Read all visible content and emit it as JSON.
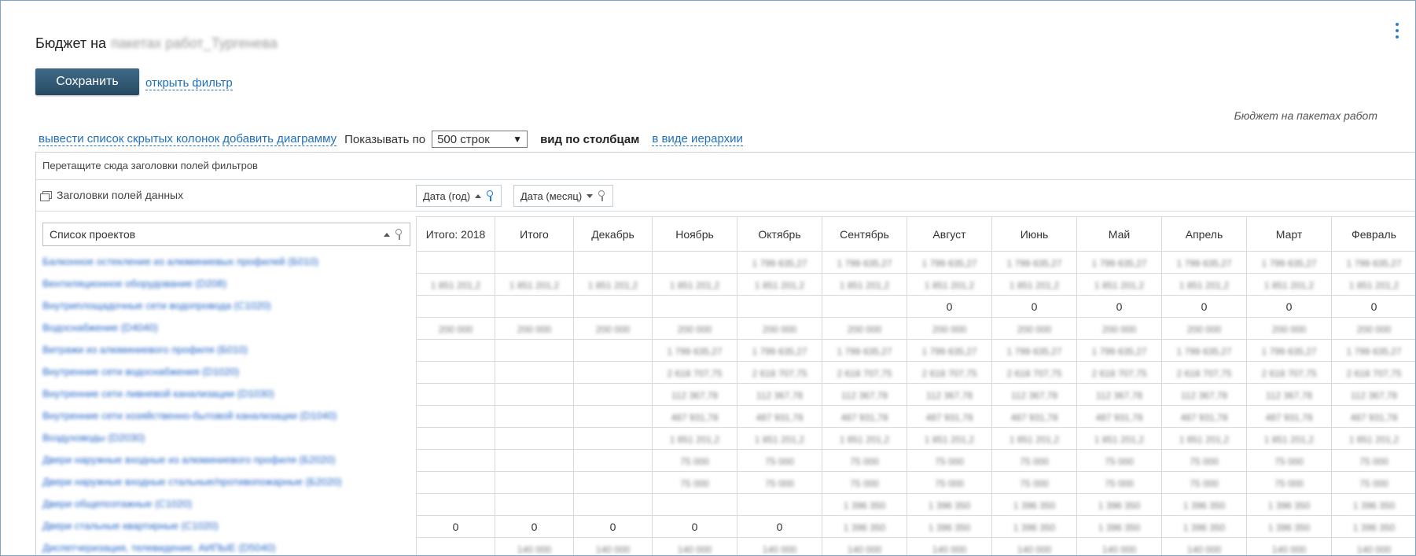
{
  "page": {
    "title_prefix": "Бюджет на",
    "title_blurred": "пакетах работ_Тургенева",
    "save_label": "Сохранить",
    "filter_link": "открыть фильтр",
    "caption": "Бюджет на пакетах работ"
  },
  "toolbar": {
    "hidden_cols_link": "вывести список скрытых колонок",
    "add_chart_link": "добавить диаграмму",
    "show_label": "Показывать по",
    "rows_select": "500 строк",
    "view_columns": "вид по столбцам",
    "view_hierarchy": "в виде иерархии"
  },
  "pivot": {
    "filter_zone": "Перетащите сюда заголовки полей фильтров",
    "data_headers_label": "Заголовки полей данных",
    "field_year": "Дата (год)",
    "field_month": "Дата (месяц)",
    "projects_header": "Список проектов",
    "columns": [
      "Итого: 2018",
      "Итого",
      "Декабрь",
      "Ноябрь",
      "Октябрь",
      "Сентябрь",
      "Август",
      "Июнь",
      "Май",
      "Апрель",
      "Март",
      "Февраль"
    ],
    "rows": [
      {
        "name": "Балконное остекление из алюминиевых профилей (Б010)",
        "cells": [
          "",
          "",
          "",
          "",
          "1 799 635,27",
          "1 799 635,27",
          "1 799 635,27",
          "1 799 635,27",
          "1 799 635,27",
          "1 799 635,27",
          "1 799 635,27",
          "1 799 635,27"
        ]
      },
      {
        "name": "Вентиляционное оборудование (D208)",
        "cells": [
          "1 851 201,2",
          "1 851 201,2",
          "1 851 201,2",
          "1 851 201,2",
          "1 851 201,2",
          "1 851 201,2",
          "1 851 201,2",
          "1 851 201,2",
          "1 851 201,2",
          "1 851 201,2",
          "1 851 201,2",
          "1 851 201,2"
        ]
      },
      {
        "name": "Внутриплощадочные сети водопровода (C1020)",
        "cells": [
          "",
          "",
          "",
          "",
          "",
          "",
          "0",
          "0",
          "0",
          "0",
          "0",
          "0"
        ]
      },
      {
        "name": "Водоснабжение (D4040)",
        "cells": [
          "200 000",
          "200 000",
          "200 000",
          "200 000",
          "200 000",
          "200 000",
          "200 000",
          "200 000",
          "200 000",
          "200 000",
          "200 000",
          "200 000"
        ]
      },
      {
        "name": "Витражи из алюминиевого профиля (Б010)",
        "cells": [
          "",
          "",
          "",
          "1 799 635,27",
          "1 799 635,27",
          "1 799 635,27",
          "1 799 635,27",
          "1 799 635,27",
          "1 799 635,27",
          "1 799 635,27",
          "1 799 635,27",
          "1 799 635,27"
        ]
      },
      {
        "name": "Внутренние сети водоснабжения (D1020)",
        "cells": [
          "",
          "",
          "",
          "2 618 707,75",
          "2 618 707,75",
          "2 618 707,75",
          "2 618 707,75",
          "2 618 707,75",
          "2 618 707,75",
          "2 618 707,75",
          "2 618 707,75",
          "2 618 707,75"
        ]
      },
      {
        "name": "Внутренние сети ливневой канализации (D1030)",
        "cells": [
          "",
          "",
          "",
          "112 367,78",
          "112 367,78",
          "112 367,78",
          "112 367,78",
          "112 367,78",
          "112 367,78",
          "112 367,78",
          "112 367,78",
          "112 367,78"
        ]
      },
      {
        "name": "Внутренние сети хозяйственно-бытовой канализации (D1040)",
        "cells": [
          "",
          "",
          "",
          "487 931,78",
          "487 931,78",
          "487 931,78",
          "487 931,78",
          "487 931,78",
          "487 931,78",
          "487 931,78",
          "487 931,78",
          "487 931,78"
        ]
      },
      {
        "name": "Воздуховоды (D2030)",
        "cells": [
          "",
          "",
          "",
          "1 851 201,2",
          "1 851 201,2",
          "1 851 201,2",
          "1 851 201,2",
          "1 851 201,2",
          "1 851 201,2",
          "1 851 201,2",
          "1 851 201,2",
          "1 851 201,2"
        ]
      },
      {
        "name": "Двери наружные входные из алюминиевого профиля (Б2020)",
        "cells": [
          "",
          "",
          "",
          "75 000",
          "75 000",
          "75 000",
          "75 000",
          "75 000",
          "75 000",
          "75 000",
          "75 000",
          "75 000"
        ]
      },
      {
        "name": "Двери наружные входные стальные/противопожарные (Б2020)",
        "cells": [
          "",
          "",
          "",
          "75 000",
          "75 000",
          "75 000",
          "75 000",
          "75 000",
          "75 000",
          "75 000",
          "75 000",
          "75 000"
        ]
      },
      {
        "name": "Двери общепоэтажные (C1020)",
        "cells": [
          "",
          "",
          "",
          "",
          "",
          "1 396 350",
          "1 396 350",
          "1 396 350",
          "1 396 350",
          "1 396 350",
          "1 396 350",
          "1 396 350"
        ]
      },
      {
        "name": "Двери стальные квартирные (C1020)",
        "cells": [
          "0",
          "0",
          "0",
          "0",
          "0",
          "1 396 350",
          "1 396 350",
          "1 396 350",
          "1 396 350",
          "1 396 350",
          "1 396 350",
          "1 396 350"
        ]
      },
      {
        "name": "Диспетчеризация, телевидение, АИПЫЕ (D5040)",
        "cells": [
          "",
          "140 000",
          "140 000",
          "140 000",
          "140 000",
          "140 000",
          "140 000",
          "140 000",
          "140 000",
          "140 000",
          "140 000",
          "140 000"
        ]
      }
    ]
  }
}
